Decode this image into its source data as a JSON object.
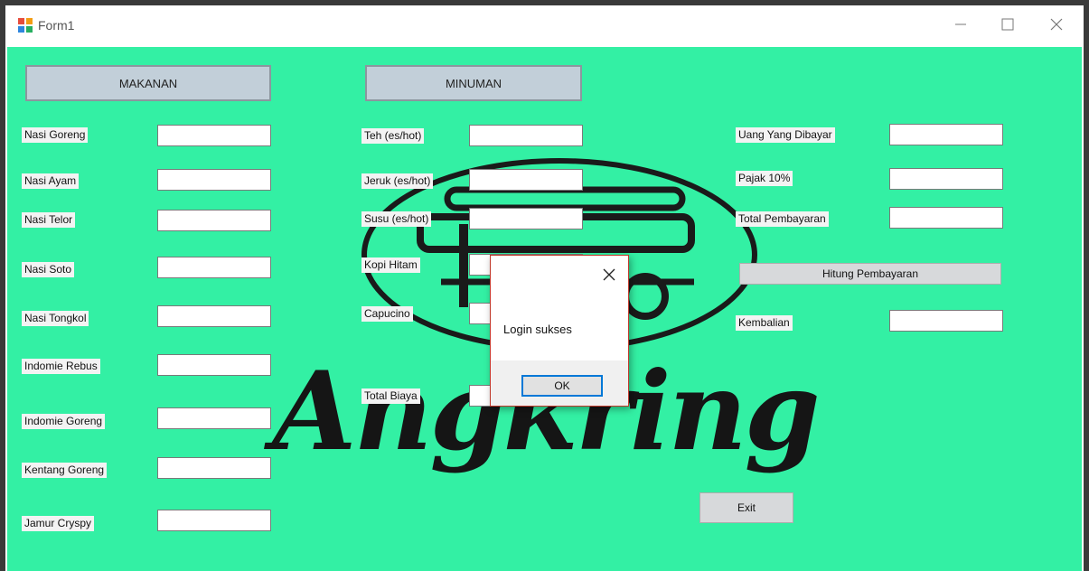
{
  "window": {
    "title": "Form1",
    "controls": [
      "minimize-icon",
      "maximize-icon",
      "close-icon"
    ]
  },
  "colors": {
    "form_background": "#33f0a4",
    "header_button": "#c2cfd9",
    "dialog_ok_border": "#0078d7"
  },
  "makanan": {
    "header": "MAKANAN",
    "items": [
      "Nasi Goreng",
      "Nasi Ayam",
      "Nasi Telor",
      "Nasi Soto",
      "Nasi Tongkol",
      "Indomie Rebus",
      "Indomie Goreng",
      "Kentang Goreng",
      "Jamur Cryspy"
    ]
  },
  "minuman": {
    "header": "MINUMAN",
    "items": [
      "Teh (es/hot)",
      "Jeruk (es/hot)",
      "Susu (es/hot)",
      "Kopi Hitam",
      "Capucino"
    ],
    "total_label": "Total Biaya"
  },
  "payment": {
    "paid_label": "Uang Yang Dibayar",
    "tax_label": "Pajak 10%",
    "total_label": "Total Pembayaran",
    "calculate_button": "Hitung Pembayaran",
    "change_label": "Kembalian",
    "exit_button": "Exit"
  },
  "background_logo": {
    "text": "Angkring"
  },
  "dialog": {
    "message": "Login sukses",
    "ok_label": "OK"
  }
}
